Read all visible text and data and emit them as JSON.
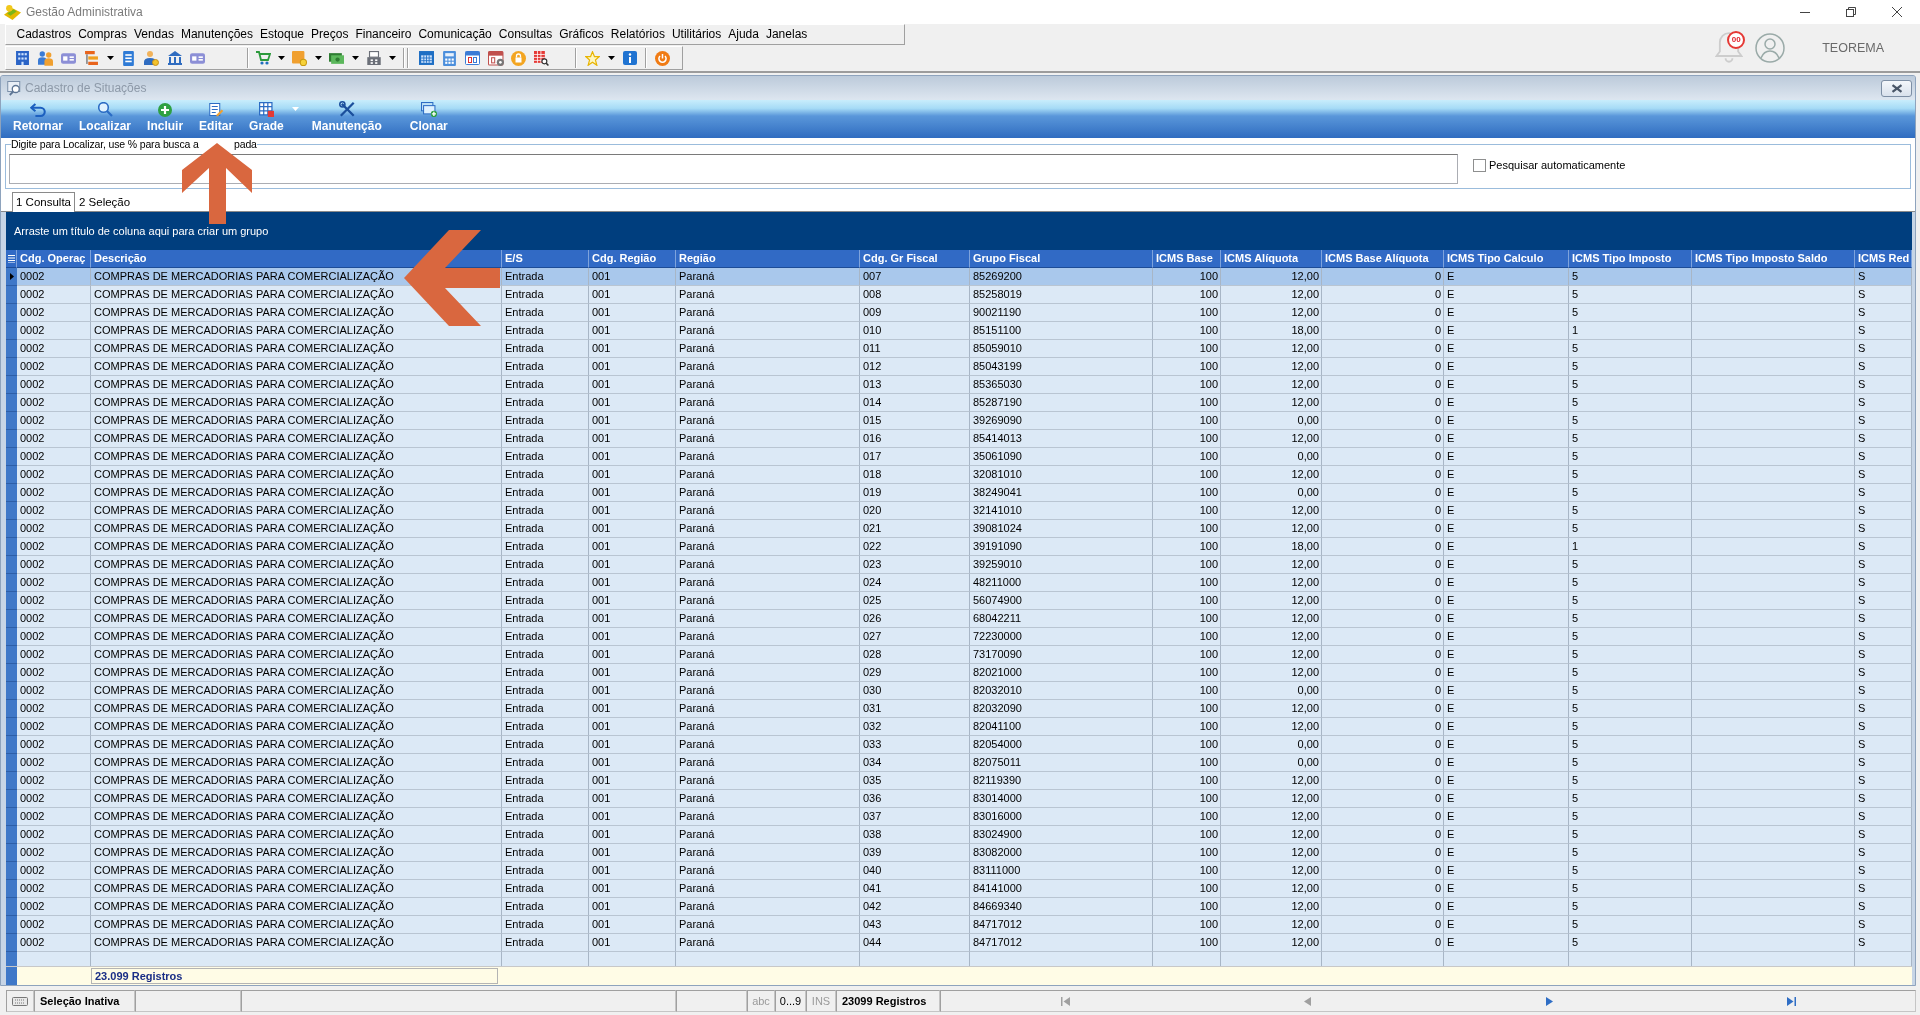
{
  "window": {
    "title": "Gestão Administrativa"
  },
  "menu": [
    "Cadastros",
    "Compras",
    "Vendas",
    "Manutenções",
    "Estoque",
    "Preços",
    "Financeiro",
    "Comunicação",
    "Consultas",
    "Gráficos",
    "Relatórios",
    "Utilitários",
    "Ajuda",
    "Janelas"
  ],
  "user": {
    "notifications": "00",
    "name": "TEOREMA"
  },
  "child_window": {
    "title": "Cadastro de Situações"
  },
  "ribbon": [
    {
      "label": "Retornar",
      "dropdown": false
    },
    {
      "label": "Localizar",
      "dropdown": false
    },
    {
      "label": "Incluir",
      "dropdown": false
    },
    {
      "label": "Editar",
      "dropdown": false
    },
    {
      "label": "Grade",
      "dropdown": true
    },
    {
      "label": "Manutenção",
      "dropdown": false
    },
    {
      "label": "Clonar",
      "dropdown": false
    }
  ],
  "search": {
    "label": "Digite para Localizar, use % para busca a",
    "label_tail": "pada",
    "auto_search": {
      "label": "Pesquisar automaticamente",
      "checked": false
    }
  },
  "tabs": [
    {
      "label": "1 Consulta",
      "selected": true
    },
    {
      "label": "2 Seleção",
      "selected": false
    }
  ],
  "grid": {
    "group_hint": "Arraste um título de coluna aqui para criar um grupo",
    "columns": [
      "Cdg. Operaç",
      "Descrição",
      "E/S",
      "Cdg. Região",
      "Região",
      "Cdg. Gr Fiscal",
      "Grupo Fiscal",
      "ICMS Base",
      "ICMS Alíquota",
      "ICMS Base Alíquota",
      "ICMS Tipo Calculo",
      "ICMS Tipo Imposto",
      "ICMS Tipo Imposto Saldo",
      "ICMS Red"
    ],
    "rows": [
      {
        "selected": true,
        "cells": [
          "0002",
          "COMPRAS DE MERCADORIAS PARA COMERCIALIZAÇÃO",
          "Entrada",
          "001",
          "Paraná",
          "007",
          "85269200",
          "100",
          "12,00",
          "0",
          "E",
          "5",
          null,
          "S"
        ]
      },
      {
        "selected": false,
        "cells": [
          "0002",
          "COMPRAS DE MERCADORIAS PARA COMERCIALIZAÇÃO",
          "Entrada",
          "001",
          "Paraná",
          "008",
          "85258019",
          "100",
          "12,00",
          "0",
          "E",
          "5",
          null,
          "S"
        ]
      },
      {
        "selected": false,
        "cells": [
          "0002",
          "COMPRAS DE MERCADORIAS PARA COMERCIALIZAÇÃO",
          "Entrada",
          "001",
          "Paraná",
          "009",
          "90021190",
          "100",
          "12,00",
          "0",
          "E",
          "5",
          null,
          "S"
        ]
      },
      {
        "selected": false,
        "cells": [
          "0002",
          "COMPRAS DE MERCADORIAS PARA COMERCIALIZAÇÃO",
          "Entrada",
          "001",
          "Paraná",
          "010",
          "85151100",
          "100",
          "18,00",
          "0",
          "E",
          "1",
          null,
          "S"
        ]
      },
      {
        "selected": false,
        "cells": [
          "0002",
          "COMPRAS DE MERCADORIAS PARA COMERCIALIZAÇÃO",
          "Entrada",
          "001",
          "Paraná",
          "011",
          "85059010",
          "100",
          "12,00",
          "0",
          "E",
          "5",
          null,
          "S"
        ]
      },
      {
        "selected": false,
        "cells": [
          "0002",
          "COMPRAS DE MERCADORIAS PARA COMERCIALIZAÇÃO",
          "Entrada",
          "001",
          "Paraná",
          "012",
          "85043199",
          "100",
          "12,00",
          "0",
          "E",
          "5",
          null,
          "S"
        ]
      },
      {
        "selected": false,
        "cells": [
          "0002",
          "COMPRAS DE MERCADORIAS PARA COMERCIALIZAÇÃO",
          "Entrada",
          "001",
          "Paraná",
          "013",
          "85365030",
          "100",
          "12,00",
          "0",
          "E",
          "5",
          null,
          "S"
        ]
      },
      {
        "selected": false,
        "cells": [
          "0002",
          "COMPRAS DE MERCADORIAS PARA COMERCIALIZAÇÃO",
          "Entrada",
          "001",
          "Paraná",
          "014",
          "85287190",
          "100",
          "12,00",
          "0",
          "E",
          "5",
          null,
          "S"
        ]
      },
      {
        "selected": false,
        "cells": [
          "0002",
          "COMPRAS DE MERCADORIAS PARA COMERCIALIZAÇÃO",
          "Entrada",
          "001",
          "Paraná",
          "015",
          "39269090",
          "100",
          "0,00",
          "0",
          "E",
          "5",
          null,
          "S"
        ]
      },
      {
        "selected": false,
        "cells": [
          "0002",
          "COMPRAS DE MERCADORIAS PARA COMERCIALIZAÇÃO",
          "Entrada",
          "001",
          "Paraná",
          "016",
          "85414013",
          "100",
          "12,00",
          "0",
          "E",
          "5",
          null,
          "S"
        ]
      },
      {
        "selected": false,
        "cells": [
          "0002",
          "COMPRAS DE MERCADORIAS PARA COMERCIALIZAÇÃO",
          "Entrada",
          "001",
          "Paraná",
          "017",
          "35061090",
          "100",
          "0,00",
          "0",
          "E",
          "5",
          null,
          "S"
        ]
      },
      {
        "selected": false,
        "cells": [
          "0002",
          "COMPRAS DE MERCADORIAS PARA COMERCIALIZAÇÃO",
          "Entrada",
          "001",
          "Paraná",
          "018",
          "32081010",
          "100",
          "12,00",
          "0",
          "E",
          "5",
          null,
          "S"
        ]
      },
      {
        "selected": false,
        "cells": [
          "0002",
          "COMPRAS DE MERCADORIAS PARA COMERCIALIZAÇÃO",
          "Entrada",
          "001",
          "Paraná",
          "019",
          "38249041",
          "100",
          "0,00",
          "0",
          "E",
          "5",
          null,
          "S"
        ]
      },
      {
        "selected": false,
        "cells": [
          "0002",
          "COMPRAS DE MERCADORIAS PARA COMERCIALIZAÇÃO",
          "Entrada",
          "001",
          "Paraná",
          "020",
          "32141010",
          "100",
          "12,00",
          "0",
          "E",
          "5",
          null,
          "S"
        ]
      },
      {
        "selected": false,
        "cells": [
          "0002",
          "COMPRAS DE MERCADORIAS PARA COMERCIALIZAÇÃO",
          "Entrada",
          "001",
          "Paraná",
          "021",
          "39081024",
          "100",
          "12,00",
          "0",
          "E",
          "5",
          null,
          "S"
        ]
      },
      {
        "selected": false,
        "cells": [
          "0002",
          "COMPRAS DE MERCADORIAS PARA COMERCIALIZAÇÃO",
          "Entrada",
          "001",
          "Paraná",
          "022",
          "39191090",
          "100",
          "18,00",
          "0",
          "E",
          "1",
          null,
          "S"
        ]
      },
      {
        "selected": false,
        "cells": [
          "0002",
          "COMPRAS DE MERCADORIAS PARA COMERCIALIZAÇÃO",
          "Entrada",
          "001",
          "Paraná",
          "023",
          "39259010",
          "100",
          "12,00",
          "0",
          "E",
          "5",
          null,
          "S"
        ]
      },
      {
        "selected": false,
        "cells": [
          "0002",
          "COMPRAS DE MERCADORIAS PARA COMERCIALIZAÇÃO",
          "Entrada",
          "001",
          "Paraná",
          "024",
          "48211000",
          "100",
          "12,00",
          "0",
          "E",
          "5",
          null,
          "S"
        ]
      },
      {
        "selected": false,
        "cells": [
          "0002",
          "COMPRAS DE MERCADORIAS PARA COMERCIALIZAÇÃO",
          "Entrada",
          "001",
          "Paraná",
          "025",
          "56074900",
          "100",
          "12,00",
          "0",
          "E",
          "5",
          null,
          "S"
        ]
      },
      {
        "selected": false,
        "cells": [
          "0002",
          "COMPRAS DE MERCADORIAS PARA COMERCIALIZAÇÃO",
          "Entrada",
          "001",
          "Paraná",
          "026",
          "68042211",
          "100",
          "12,00",
          "0",
          "E",
          "5",
          null,
          "S"
        ]
      },
      {
        "selected": false,
        "cells": [
          "0002",
          "COMPRAS DE MERCADORIAS PARA COMERCIALIZAÇÃO",
          "Entrada",
          "001",
          "Paraná",
          "027",
          "72230000",
          "100",
          "12,00",
          "0",
          "E",
          "5",
          null,
          "S"
        ]
      },
      {
        "selected": false,
        "cells": [
          "0002",
          "COMPRAS DE MERCADORIAS PARA COMERCIALIZAÇÃO",
          "Entrada",
          "001",
          "Paraná",
          "028",
          "73170090",
          "100",
          "12,00",
          "0",
          "E",
          "5",
          null,
          "S"
        ]
      },
      {
        "selected": false,
        "cells": [
          "0002",
          "COMPRAS DE MERCADORIAS PARA COMERCIALIZAÇÃO",
          "Entrada",
          "001",
          "Paraná",
          "029",
          "82021000",
          "100",
          "12,00",
          "0",
          "E",
          "5",
          null,
          "S"
        ]
      },
      {
        "selected": false,
        "cells": [
          "0002",
          "COMPRAS DE MERCADORIAS PARA COMERCIALIZAÇÃO",
          "Entrada",
          "001",
          "Paraná",
          "030",
          "82032010",
          "100",
          "0,00",
          "0",
          "E",
          "5",
          null,
          "S"
        ]
      },
      {
        "selected": false,
        "cells": [
          "0002",
          "COMPRAS DE MERCADORIAS PARA COMERCIALIZAÇÃO",
          "Entrada",
          "001",
          "Paraná",
          "031",
          "82032090",
          "100",
          "12,00",
          "0",
          "E",
          "5",
          null,
          "S"
        ]
      },
      {
        "selected": false,
        "cells": [
          "0002",
          "COMPRAS DE MERCADORIAS PARA COMERCIALIZAÇÃO",
          "Entrada",
          "001",
          "Paraná",
          "032",
          "82041100",
          "100",
          "12,00",
          "0",
          "E",
          "5",
          null,
          "S"
        ]
      },
      {
        "selected": false,
        "cells": [
          "0002",
          "COMPRAS DE MERCADORIAS PARA COMERCIALIZAÇÃO",
          "Entrada",
          "001",
          "Paraná",
          "033",
          "82054000",
          "100",
          "0,00",
          "0",
          "E",
          "5",
          null,
          "S"
        ]
      },
      {
        "selected": false,
        "cells": [
          "0002",
          "COMPRAS DE MERCADORIAS PARA COMERCIALIZAÇÃO",
          "Entrada",
          "001",
          "Paraná",
          "034",
          "82075011",
          "100",
          "0,00",
          "0",
          "E",
          "5",
          null,
          "S"
        ]
      },
      {
        "selected": false,
        "cells": [
          "0002",
          "COMPRAS DE MERCADORIAS PARA COMERCIALIZAÇÃO",
          "Entrada",
          "001",
          "Paraná",
          "035",
          "82119390",
          "100",
          "12,00",
          "0",
          "E",
          "5",
          null,
          "S"
        ]
      },
      {
        "selected": false,
        "cells": [
          "0002",
          "COMPRAS DE MERCADORIAS PARA COMERCIALIZAÇÃO",
          "Entrada",
          "001",
          "Paraná",
          "036",
          "83014000",
          "100",
          "12,00",
          "0",
          "E",
          "5",
          null,
          "S"
        ]
      },
      {
        "selected": false,
        "cells": [
          "0002",
          "COMPRAS DE MERCADORIAS PARA COMERCIALIZAÇÃO",
          "Entrada",
          "001",
          "Paraná",
          "037",
          "83016000",
          "100",
          "12,00",
          "0",
          "E",
          "5",
          null,
          "S"
        ]
      },
      {
        "selected": false,
        "cells": [
          "0002",
          "COMPRAS DE MERCADORIAS PARA COMERCIALIZAÇÃO",
          "Entrada",
          "001",
          "Paraná",
          "038",
          "83024900",
          "100",
          "12,00",
          "0",
          "E",
          "5",
          null,
          "S"
        ]
      },
      {
        "selected": false,
        "cells": [
          "0002",
          "COMPRAS DE MERCADORIAS PARA COMERCIALIZAÇÃO",
          "Entrada",
          "001",
          "Paraná",
          "039",
          "83082000",
          "100",
          "12,00",
          "0",
          "E",
          "5",
          null,
          "S"
        ]
      },
      {
        "selected": false,
        "cells": [
          "0002",
          "COMPRAS DE MERCADORIAS PARA COMERCIALIZAÇÃO",
          "Entrada",
          "001",
          "Paraná",
          "040",
          "83111000",
          "100",
          "12,00",
          "0",
          "E",
          "5",
          null,
          "S"
        ]
      },
      {
        "selected": false,
        "cells": [
          "0002",
          "COMPRAS DE MERCADORIAS PARA COMERCIALIZAÇÃO",
          "Entrada",
          "001",
          "Paraná",
          "041",
          "84141000",
          "100",
          "12,00",
          "0",
          "E",
          "5",
          null,
          "S"
        ]
      },
      {
        "selected": false,
        "cells": [
          "0002",
          "COMPRAS DE MERCADORIAS PARA COMERCIALIZAÇÃO",
          "Entrada",
          "001",
          "Paraná",
          "042",
          "84669340",
          "100",
          "12,00",
          "0",
          "E",
          "5",
          null,
          "S"
        ]
      },
      {
        "selected": false,
        "cells": [
          "0002",
          "COMPRAS DE MERCADORIAS PARA COMERCIALIZAÇÃO",
          "Entrada",
          "001",
          "Paraná",
          "043",
          "84717012",
          "100",
          "12,00",
          "0",
          "E",
          "5",
          null,
          "S"
        ]
      },
      {
        "selected": false,
        "cells": [
          "0002",
          "COMPRAS DE MERCADORIAS PARA COMERCIALIZAÇÃO",
          "Entrada",
          "001",
          "Paraná",
          "044",
          "84717012",
          "100",
          "12,00",
          "0",
          "E",
          "5",
          null,
          "S"
        ]
      }
    ],
    "summary": "23.099 Registros"
  },
  "status_bar": {
    "selection": "Seleção Inativa",
    "indicators": [
      {
        "label": "abc",
        "disabled": true
      },
      {
        "label": "0...9",
        "disabled": false
      },
      {
        "label": "INS",
        "disabled": true
      }
    ],
    "records": "23099 Registros",
    "navigation": [
      {
        "kind": "first",
        "disabled": true
      },
      {
        "kind": "previous",
        "disabled": true
      },
      {
        "kind": "next",
        "disabled": false
      },
      {
        "kind": "last",
        "disabled": false
      }
    ]
  },
  "annotations": [
    {
      "kind": "up-arrow"
    },
    {
      "kind": "left-arrow"
    }
  ]
}
